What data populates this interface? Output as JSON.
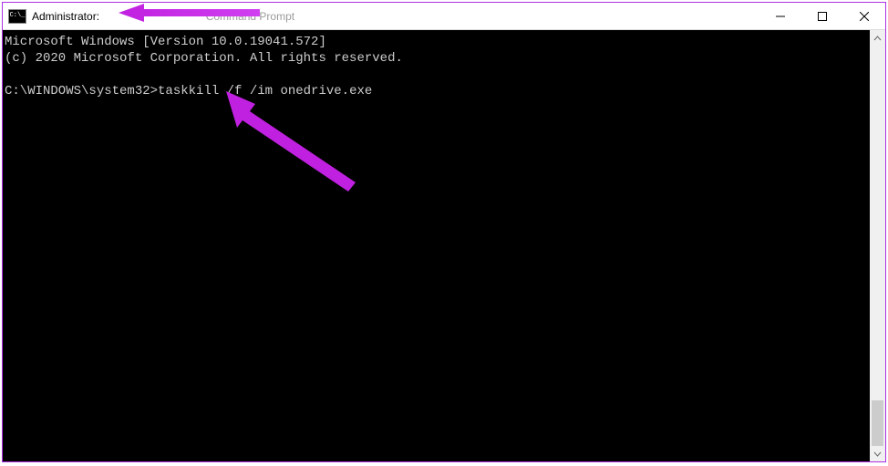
{
  "window": {
    "title_prefix": "Administrator:",
    "title_suffix": "Command Prompt"
  },
  "terminal": {
    "line1": "Microsoft Windows [Version 10.0.19041.572]",
    "line2": "(c) 2020 Microsoft Corporation. All rights reserved.",
    "blank": "",
    "prompt": "C:\\WINDOWS\\system32>",
    "command": "taskkill /f /im onedrive.exe"
  },
  "annotations": {
    "arrow_color": "#c020e0"
  }
}
